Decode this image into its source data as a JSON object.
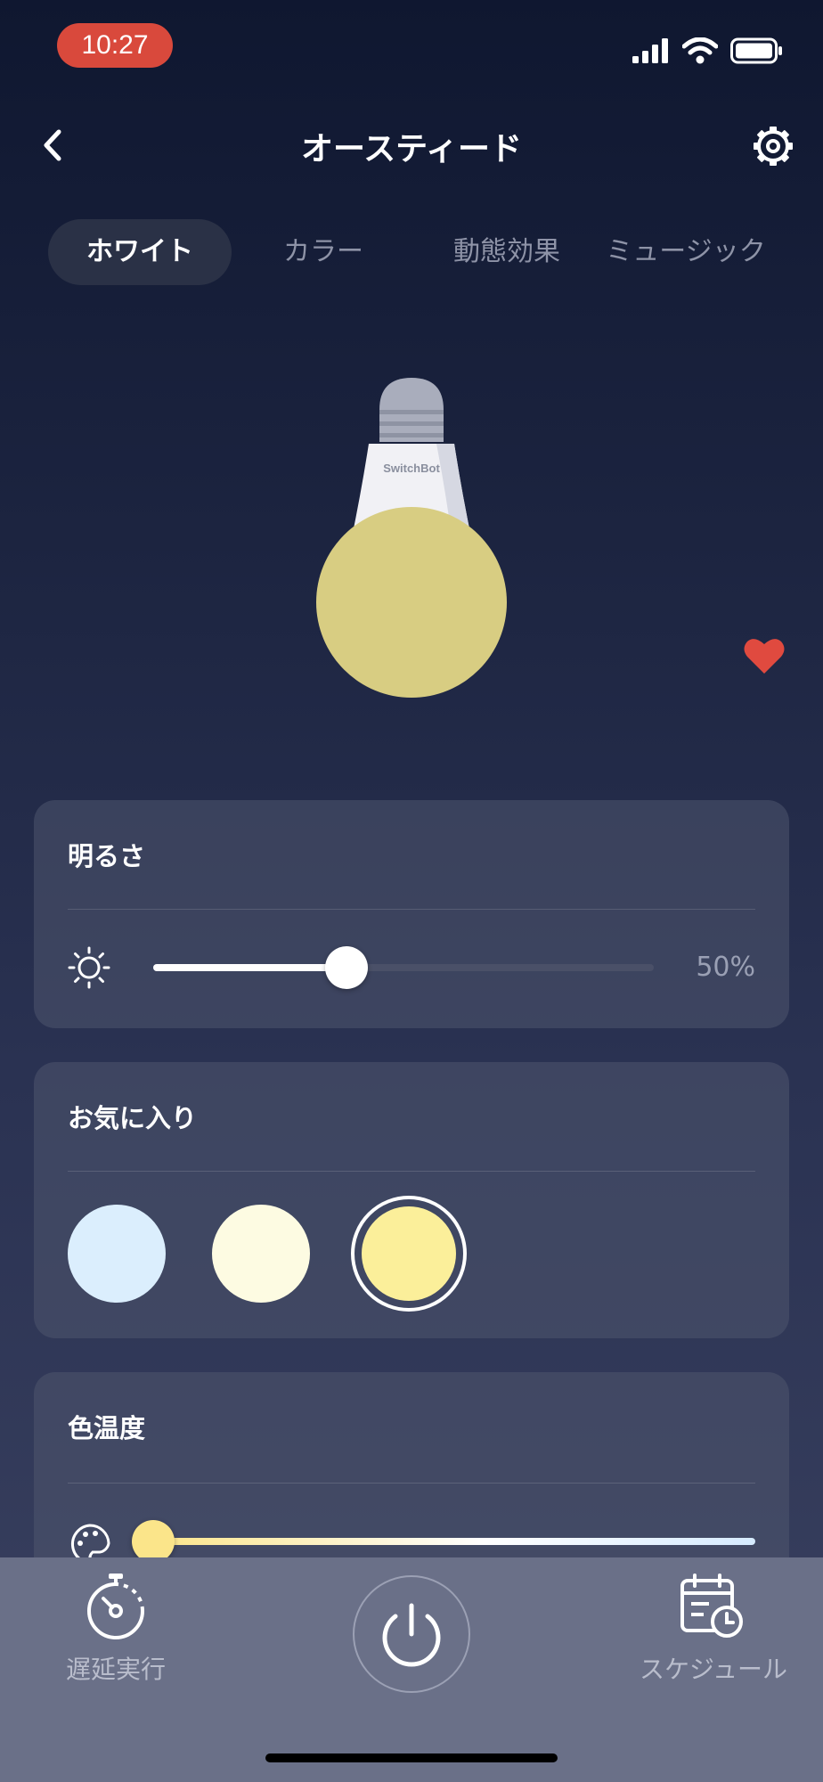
{
  "status": {
    "time": "10:27"
  },
  "nav": {
    "title": "オースティード"
  },
  "tabs": [
    {
      "label": "ホワイト"
    },
    {
      "label": "カラー"
    },
    {
      "label": "動態効果"
    },
    {
      "label": "ミュージック"
    }
  ],
  "bulb": {
    "brand": "SwitchBot",
    "glow_color": "#d8cd82"
  },
  "brightness": {
    "title": "明るさ",
    "value_text": "50%",
    "value": 0.5
  },
  "favorites": {
    "title": "お気に入り",
    "colors": [
      "#dbeefd",
      "#fdfbe2",
      "#fbef9a"
    ],
    "selected_index": 2
  },
  "color_temp": {
    "title": "色温度",
    "value": 0.0
  },
  "bottom": {
    "timer_label": "遅延実行",
    "schedule_label": "スケジュール"
  },
  "colors": {
    "accent_red": "#d9493c",
    "heart": "#e04a3f"
  }
}
